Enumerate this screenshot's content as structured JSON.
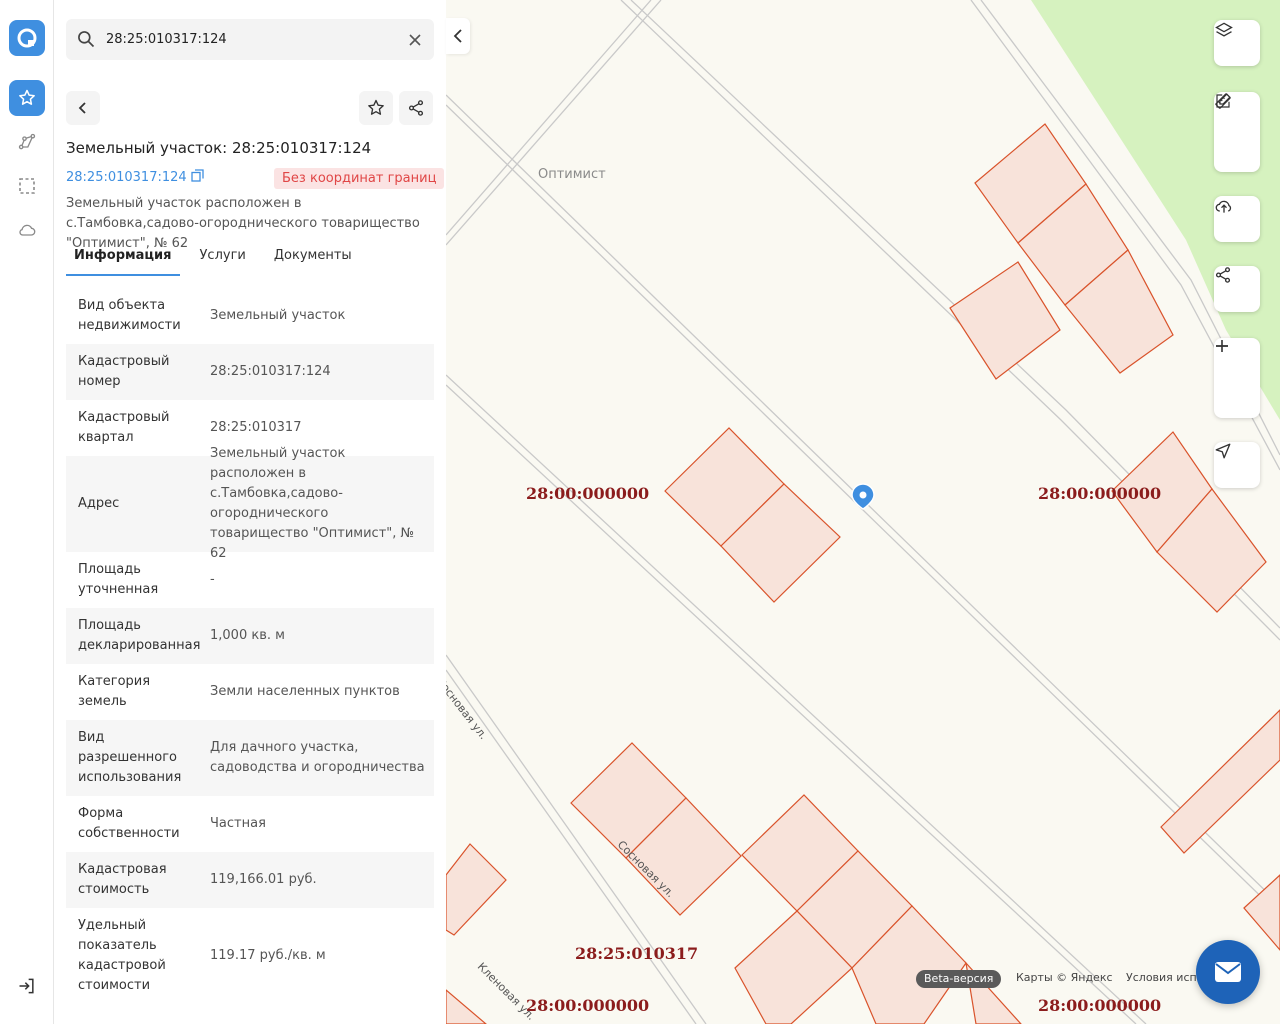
{
  "search": {
    "value": "28:25:010317:124"
  },
  "panel": {
    "title": "Земельный участок: 28:25:010317:124",
    "cad_link": "28:25:010317:124",
    "badge": "Без координат границ",
    "description": "Земельный участок расположен в с.Тамбовка,садово-огороднического товарищество \"Оптимист\", № 62",
    "tabs": [
      "Информация",
      "Услуги",
      "Документы"
    ],
    "rows": [
      {
        "key": "Вид объекта недвижимости",
        "value": "Земельный участок"
      },
      {
        "key": "Кадастровый номер",
        "value": "28:25:010317:124"
      },
      {
        "key": "Кадастровый квартал",
        "value": "28:25:010317"
      },
      {
        "key": "Адрес",
        "value": "Земельный участок расположен в с.Тамбовка,садово-огороднического товарищество \"Оптимист\", № 62"
      },
      {
        "key": "Площадь уточненная",
        "value": "-"
      },
      {
        "key": "Площадь декларированная",
        "value": "1,000 кв. м"
      },
      {
        "key": "Категория земель",
        "value": "Земли населенных пунктов"
      },
      {
        "key": "Вид разрешенного использования",
        "value": "Для дачного участка, садоводства и огородничества"
      },
      {
        "key": "Форма собственности",
        "value": "Частная"
      },
      {
        "key": "Кадастровая стоимость",
        "value": "119,166.01 руб."
      },
      {
        "key": "Удельный показатель кадастровой стоимости",
        "value": "119.17 руб./кв. м"
      }
    ]
  },
  "map": {
    "place_label": "Оптимист",
    "zone_labels": {
      "left_mid": "28:00:000000",
      "right_mid": "28:00:000000",
      "quarter": "28:25:010317",
      "left_bottom": "28:00:000000",
      "right_bottom": "28:00:000000"
    },
    "streets": {
      "sosnovaya_top": "Сосновая ул.",
      "sosnovaya": "Сосновая ул.",
      "klenovaya": "Кленовая ул."
    },
    "beta": "Beta-версия",
    "attribution": [
      "Карты © Яндекс",
      "Условия испол"
    ]
  },
  "colors": {
    "accent": "#3f8fe0",
    "parcel_fill": "#f8e3da",
    "parcel_stroke": "#d9532b",
    "zone_label": "#8b1c1c",
    "green_area": "#d6f2bf",
    "badge_bg": "#fbe3e3",
    "badge_text": "#e04646"
  }
}
